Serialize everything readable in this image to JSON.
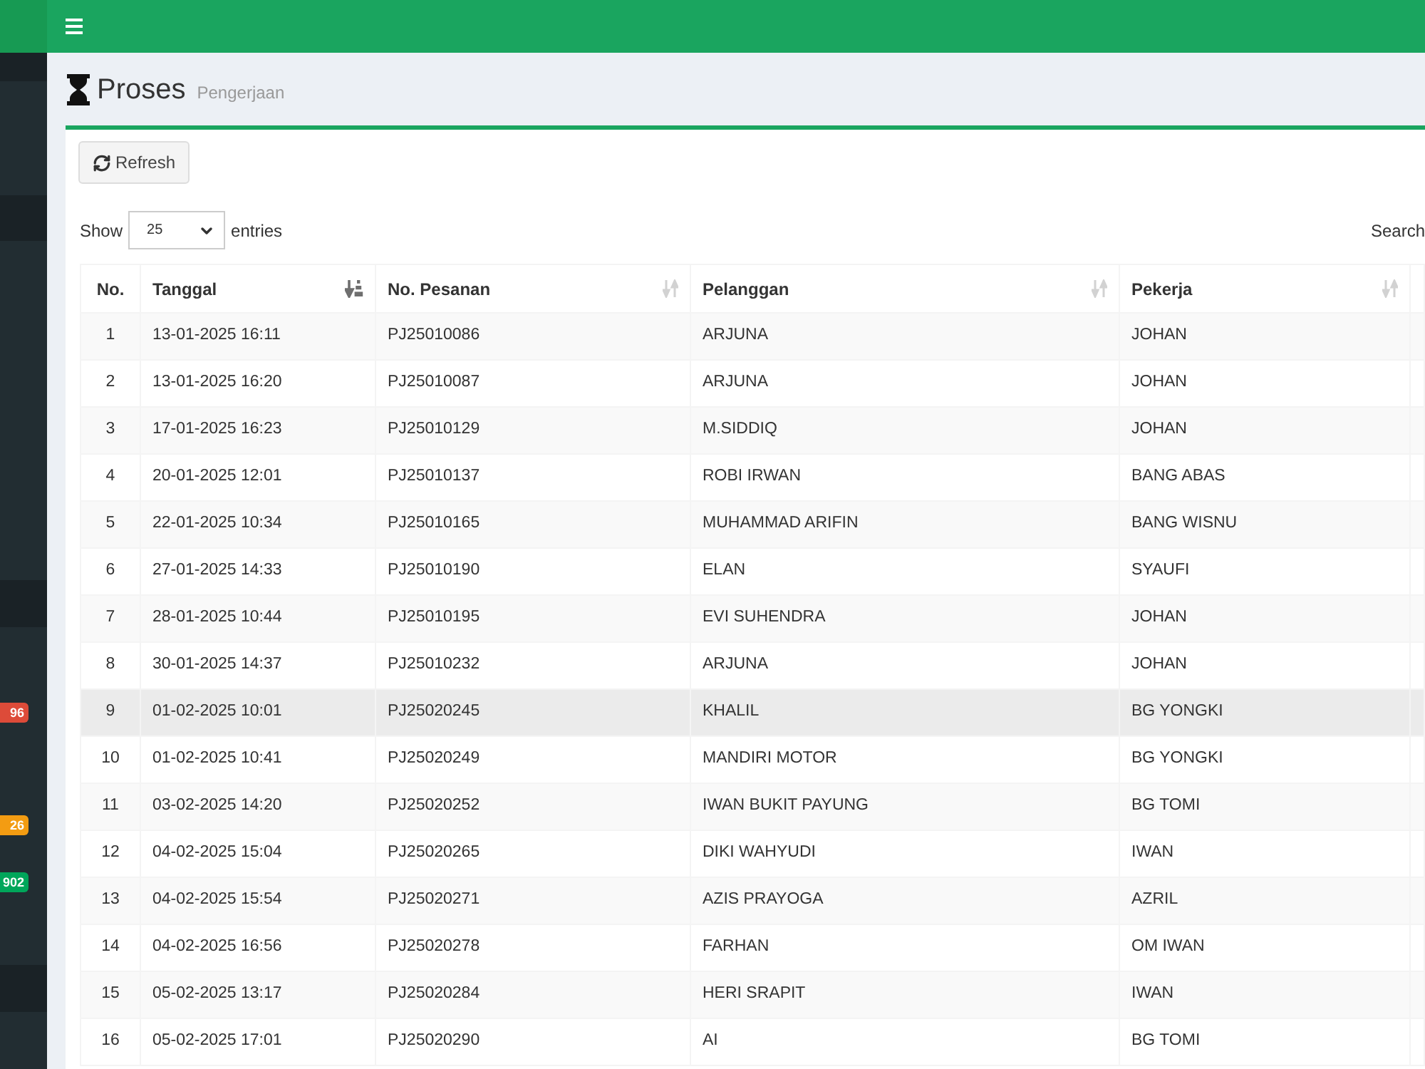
{
  "sidebar": {
    "badges": [
      {
        "text": "96",
        "color": "#dd4b39"
      },
      {
        "text": "26",
        "color": "#f39c12"
      },
      {
        "text": "902",
        "color": "#00a65a"
      }
    ]
  },
  "page": {
    "title": "Proses",
    "subtitle": "Pengerjaan"
  },
  "toolbar": {
    "refresh_button": "Refresh"
  },
  "table_controls": {
    "show_label": "Show",
    "page_size": "25",
    "entries_label": "entries",
    "search_label": "Search"
  },
  "table": {
    "columns": [
      {
        "label": "No.",
        "sortable": false,
        "sorted": false
      },
      {
        "label": "Tanggal",
        "sortable": true,
        "sorted": true
      },
      {
        "label": "No. Pesanan",
        "sortable": true,
        "sorted": false
      },
      {
        "label": "Pelanggan",
        "sortable": true,
        "sorted": false
      },
      {
        "label": "Pekerja",
        "sortable": true,
        "sorted": false
      }
    ],
    "rows": [
      {
        "cells": [
          "1",
          "13-01-2025 16:11",
          "PJ25010086",
          "ARJUNA",
          "JOHAN"
        ],
        "hovered": false
      },
      {
        "cells": [
          "2",
          "13-01-2025 16:20",
          "PJ25010087",
          "ARJUNA",
          "JOHAN"
        ],
        "hovered": false
      },
      {
        "cells": [
          "3",
          "17-01-2025 16:23",
          "PJ25010129",
          "M.SIDDIQ",
          "JOHAN"
        ],
        "hovered": false
      },
      {
        "cells": [
          "4",
          "20-01-2025 12:01",
          "PJ25010137",
          "ROBI IRWAN",
          "BANG ABAS"
        ],
        "hovered": false
      },
      {
        "cells": [
          "5",
          "22-01-2025 10:34",
          "PJ25010165",
          "MUHAMMAD ARIFIN",
          "BANG WISNU"
        ],
        "hovered": false
      },
      {
        "cells": [
          "6",
          "27-01-2025 14:33",
          "PJ25010190",
          "ELAN",
          "SYAUFI"
        ],
        "hovered": false
      },
      {
        "cells": [
          "7",
          "28-01-2025 10:44",
          "PJ25010195",
          "EVI SUHENDRA",
          "JOHAN"
        ],
        "hovered": false
      },
      {
        "cells": [
          "8",
          "30-01-2025 14:37",
          "PJ25010232",
          "ARJUNA",
          "JOHAN"
        ],
        "hovered": false
      },
      {
        "cells": [
          "9",
          "01-02-2025 10:01",
          "PJ25020245",
          "KHALIL",
          "BG YONGKI"
        ],
        "hovered": true
      },
      {
        "cells": [
          "10",
          "01-02-2025 10:41",
          "PJ25020249",
          "MANDIRI MOTOR",
          "BG YONGKI"
        ],
        "hovered": false
      },
      {
        "cells": [
          "11",
          "03-02-2025 14:20",
          "PJ25020252",
          "IWAN BUKIT PAYUNG",
          "BG TOMI"
        ],
        "hovered": false
      },
      {
        "cells": [
          "12",
          "04-02-2025 15:04",
          "PJ25020265",
          "DIKI WAHYUDI",
          "IWAN"
        ],
        "hovered": false
      },
      {
        "cells": [
          "13",
          "04-02-2025 15:54",
          "PJ25020271",
          "AZIS PRAYOGA",
          "AZRIL"
        ],
        "hovered": false
      },
      {
        "cells": [
          "14",
          "04-02-2025 16:56",
          "PJ25020278",
          "FARHAN",
          "OM IWAN"
        ],
        "hovered": false
      },
      {
        "cells": [
          "15",
          "05-02-2025 13:17",
          "PJ25020284",
          "HERI SRAPIT",
          "IWAN"
        ],
        "hovered": false
      },
      {
        "cells": [
          "16",
          "05-02-2025 17:01",
          "PJ25020290",
          "AI",
          "BG TOMI"
        ],
        "hovered": false
      }
    ]
  }
}
